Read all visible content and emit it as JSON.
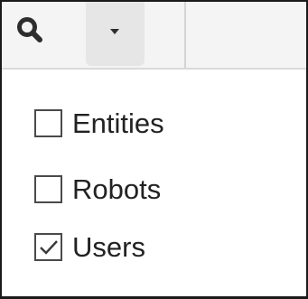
{
  "toolbar": {
    "search_icon": "search-icon",
    "dropdown_icon": "caret-down-icon",
    "icon_color": "#2d2d2d",
    "background": "#f4f4f4",
    "dropdown_background": "#e6e6e6"
  },
  "filter_menu": {
    "items": [
      {
        "label": "Entities",
        "checked": false
      },
      {
        "label": "Robots",
        "checked": false
      },
      {
        "label": "Users",
        "checked": true
      }
    ]
  }
}
